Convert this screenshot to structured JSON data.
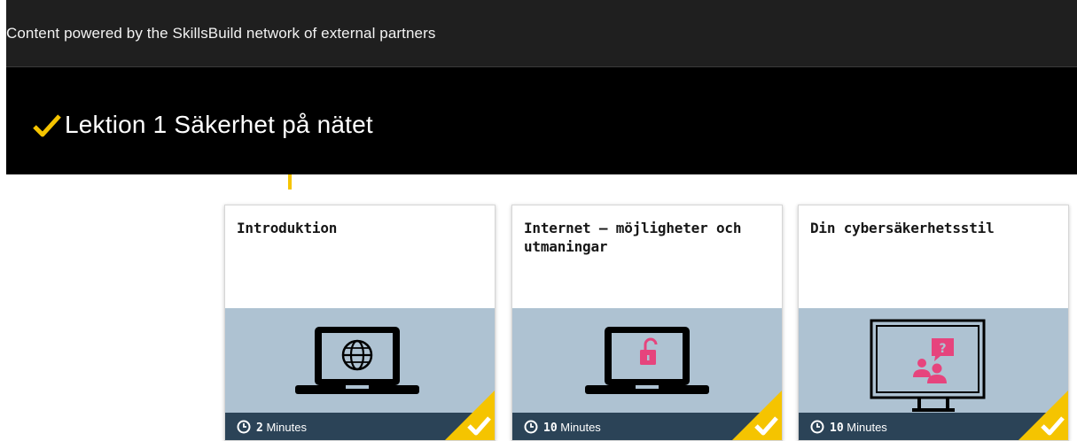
{
  "header": {
    "notice": "Content powered by the SkillsBuild network of external partners"
  },
  "lesson": {
    "title": "Lektion 1 Säkerhet på nätet",
    "completed": true,
    "accent_color": "#f5c400"
  },
  "cards": [
    {
      "title": "Introduktion",
      "duration_value": "2",
      "duration_unit": "Minutes",
      "icon": "laptop-globe-icon",
      "completed": true
    },
    {
      "title": "Internet – möjligheter och utmaningar",
      "duration_value": "10",
      "duration_unit": "Minutes",
      "icon": "laptop-unlocked-padlock-icon",
      "completed": true
    },
    {
      "title": "Din cybersäkerhetsstil",
      "duration_value": "10",
      "duration_unit": "Minutes",
      "icon": "monitor-people-question-icon",
      "completed": true
    }
  ],
  "colors": {
    "thumb_bg": "#aec2d2",
    "footer_bg": "#2b4357",
    "icon_accent": "#e6447d",
    "complete_badge": "#f5c400"
  }
}
